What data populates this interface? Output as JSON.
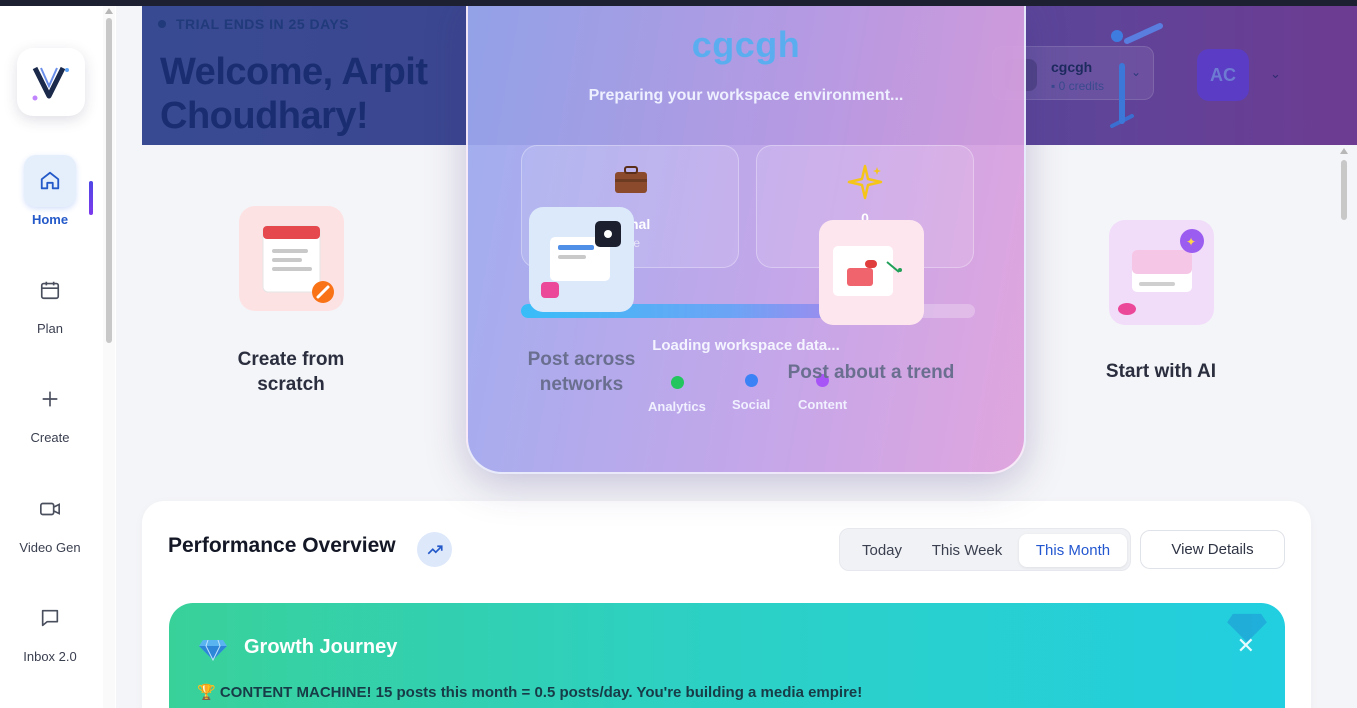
{
  "sidebar": {
    "items": [
      {
        "label": "Home",
        "icon": "home-icon",
        "active": true
      },
      {
        "label": "Plan",
        "icon": "calendar-icon"
      },
      {
        "label": "Create",
        "icon": "plus-icon"
      },
      {
        "label": "Video Gen",
        "icon": "video-icon"
      },
      {
        "label": "Inbox 2.0",
        "icon": "chat-icon"
      }
    ]
  },
  "header": {
    "trial_text": "TRIAL ENDS IN 25 DAYS",
    "welcome_line1": "Welcome, Arpit",
    "welcome_line2": "Choudhary!",
    "workspace_name": "cgcgh",
    "credits": "0 credits",
    "avatar_initials": "AC"
  },
  "quick_actions": [
    {
      "label_line1": "Create from",
      "label_line2": "scratch"
    },
    {
      "label_line1": "Post across",
      "label_line2": "networks"
    },
    {
      "label_line1": "Post about a trend",
      "label_line2": ""
    },
    {
      "label_line1": "Start with AI",
      "label_line2": ""
    }
  ],
  "performance": {
    "title": "Performance Overview",
    "tabs": [
      "Today",
      "This Week",
      "This Month"
    ],
    "selected_tab": "This Month",
    "view_details": "View Details",
    "growth": {
      "title": "Growth Journey",
      "message": "🏆 CONTENT MACHINE! 15 posts this month = 0.5 posts/day. You're building a media empire!"
    }
  },
  "modal": {
    "workspace_name": "cgcgh",
    "subtitle": "Preparing your workspace environment...",
    "box1_value": "sional",
    "box1_sub": "ode",
    "box2_value": "0",
    "progress": 0.68,
    "loading_text": "Loading workspace data...",
    "steps": [
      {
        "label": "Analytics",
        "color": "#22c55e"
      },
      {
        "label": "Social",
        "color": "#3b82f6"
      },
      {
        "label": "Content",
        "color": "#a855f7"
      }
    ]
  },
  "colors": {
    "accent": "#2459c9",
    "hero_start": "#4559a8",
    "hero_end": "#8b45a8",
    "growth_start": "#39d19a",
    "growth_end": "#22cfe0"
  }
}
